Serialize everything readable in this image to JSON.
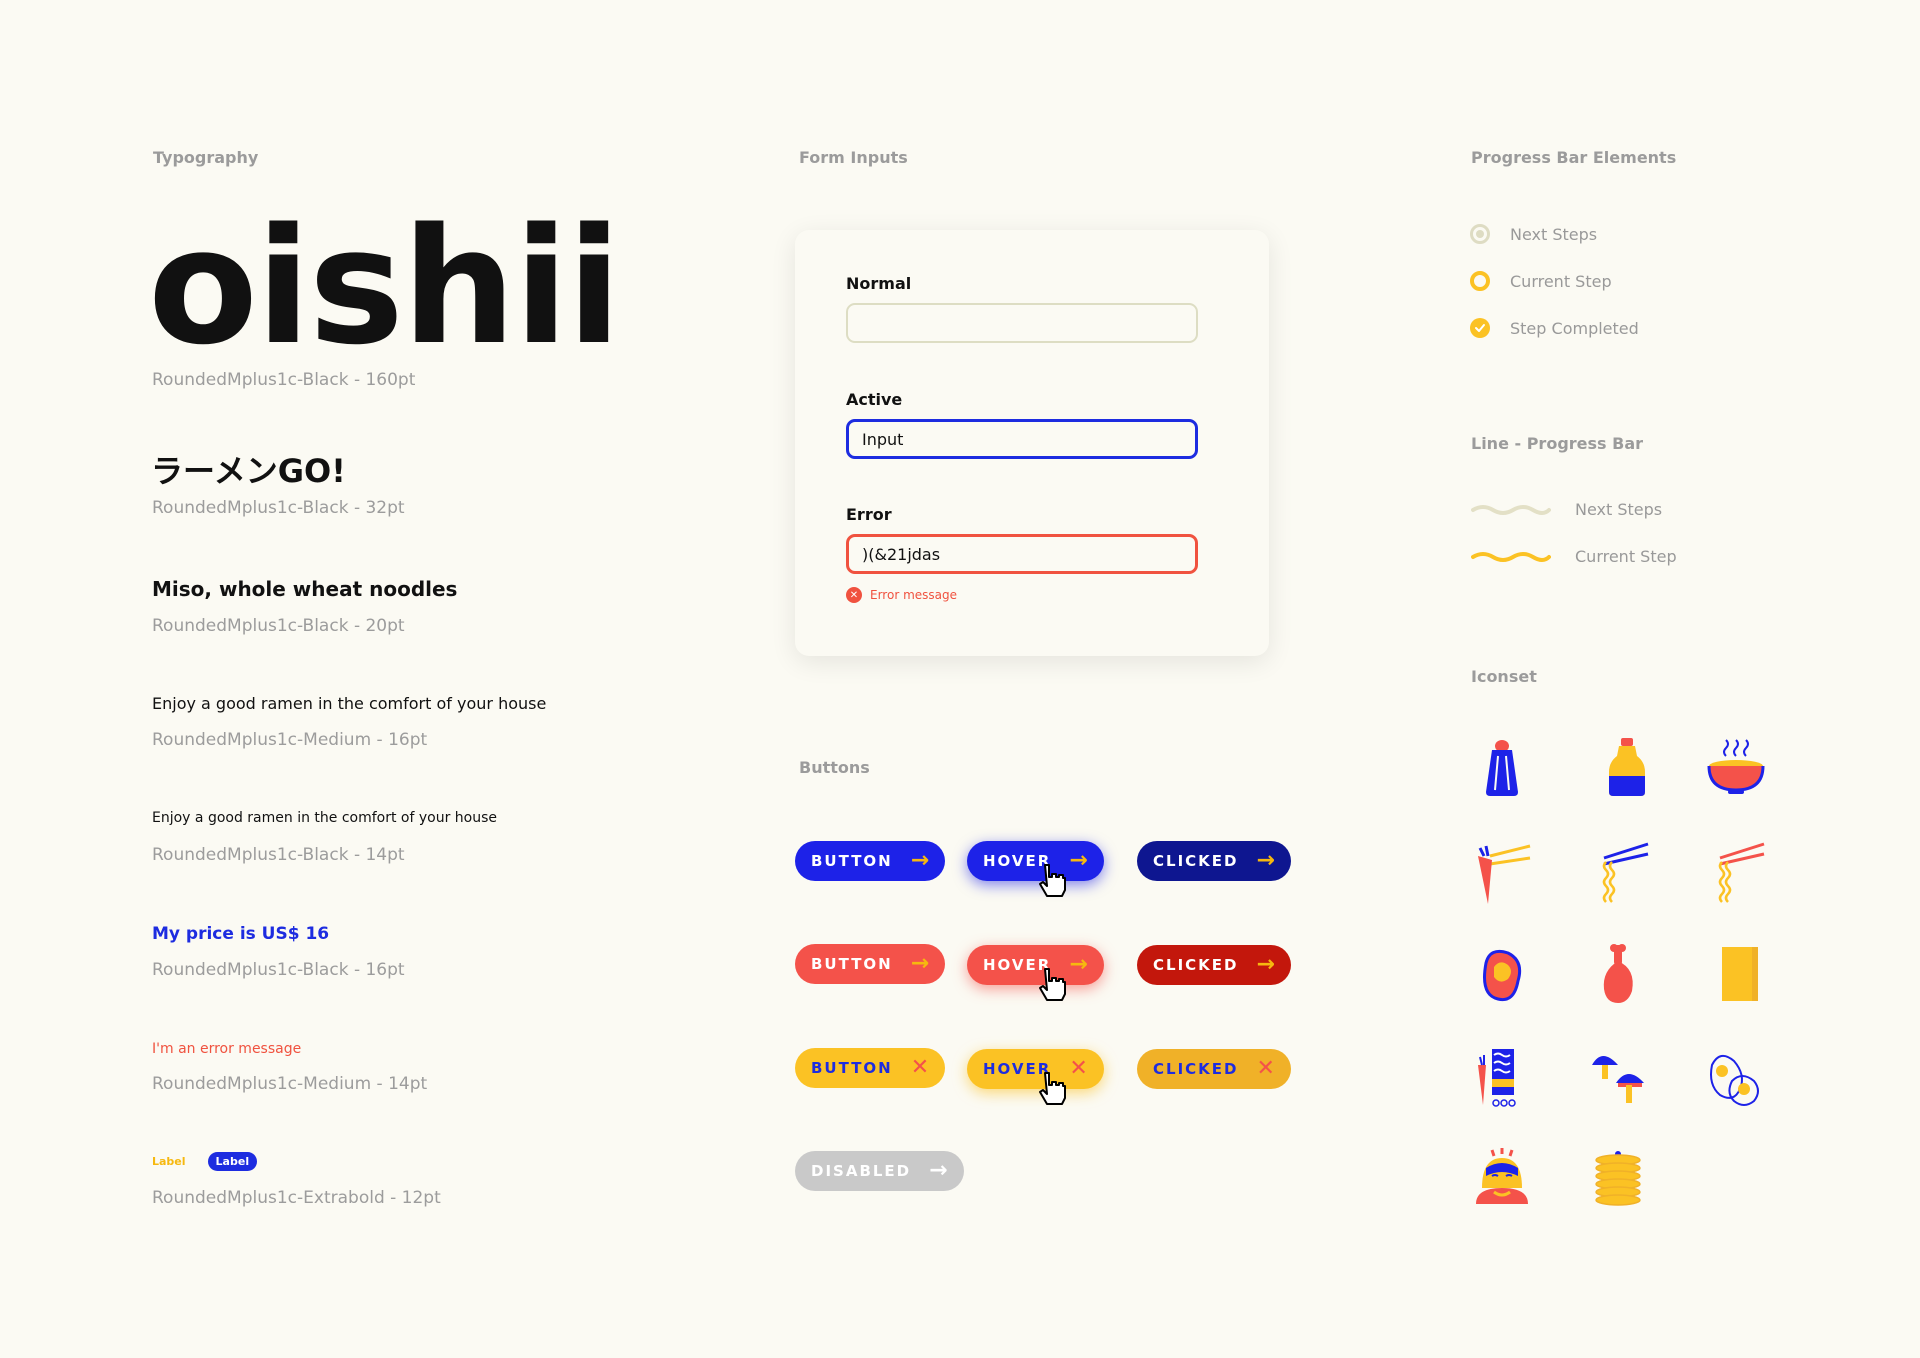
{
  "typography": {
    "title": "Typography",
    "samples": [
      {
        "text": "oishii",
        "caption": "RoundedMplus1c-Black  - 160pt"
      },
      {
        "text": "ラーメンGO!",
        "caption": "RoundedMplus1c-Black  - 32pt"
      },
      {
        "text": "Miso, whole wheat noodles",
        "caption": "RoundedMplus1c-Black  - 20pt"
      },
      {
        "text": "Enjoy a good ramen in the comfort of your house",
        "caption": "RoundedMplus1c-Medium  - 16pt"
      },
      {
        "text": "Enjoy a good ramen in the comfort of your house",
        "caption": "RoundedMplus1c-Black  - 14pt"
      },
      {
        "text": "My price is US$ 16",
        "caption": "RoundedMplus1c-Black  - 16pt"
      },
      {
        "text": "I'm an error message",
        "caption": "RoundedMplus1c-Medium - 14pt"
      },
      {
        "label_plain": "Label",
        "label_pill": "Label",
        "caption": "RoundedMplus1c-Extrabold - 12pt"
      }
    ]
  },
  "form_inputs": {
    "title": "Form Inputs",
    "normal": {
      "label": "Normal",
      "value": ""
    },
    "active": {
      "label": "Active",
      "value": "Input"
    },
    "error": {
      "label": "Error",
      "value": ")(&21jdas",
      "message": "Error message"
    }
  },
  "buttons": {
    "title": "Buttons",
    "button_label": "BUTTON",
    "hover_label": "HOVER",
    "clicked_label": "CLICKED",
    "disabled_label": "DISABLED",
    "colors": {
      "blue": "#1d22e8",
      "red": "#f4524a",
      "yellow": "#fbc224",
      "disabled": "#c9c9c9"
    }
  },
  "progress": {
    "title": "Progress Bar Elements",
    "steps": [
      {
        "label": "Next Steps",
        "state": "next"
      },
      {
        "label": "Current Step",
        "state": "current"
      },
      {
        "label": "Step Completed",
        "state": "completed"
      }
    ],
    "line_title": "Line - Progress Bar",
    "lines": [
      {
        "label": "Next Steps",
        "color": "#e3e0c6"
      },
      {
        "label": "Current Step",
        "color": "#fbc224"
      }
    ]
  },
  "iconset": {
    "title": "Iconset",
    "icons": [
      "salt-shaker-icon",
      "soy-sauce-icon",
      "ramen-bowl-icon",
      "carrot-chopsticks-icon",
      "noodles-blue-chopsticks-icon",
      "noodles-red-chopsticks-icon",
      "meat-icon",
      "chicken-leg-icon",
      "nori-sheet-icon",
      "ingredients-icon",
      "mushrooms-icon",
      "eggs-icon",
      "chef-character-icon",
      "fish-cake-stack-icon"
    ]
  }
}
